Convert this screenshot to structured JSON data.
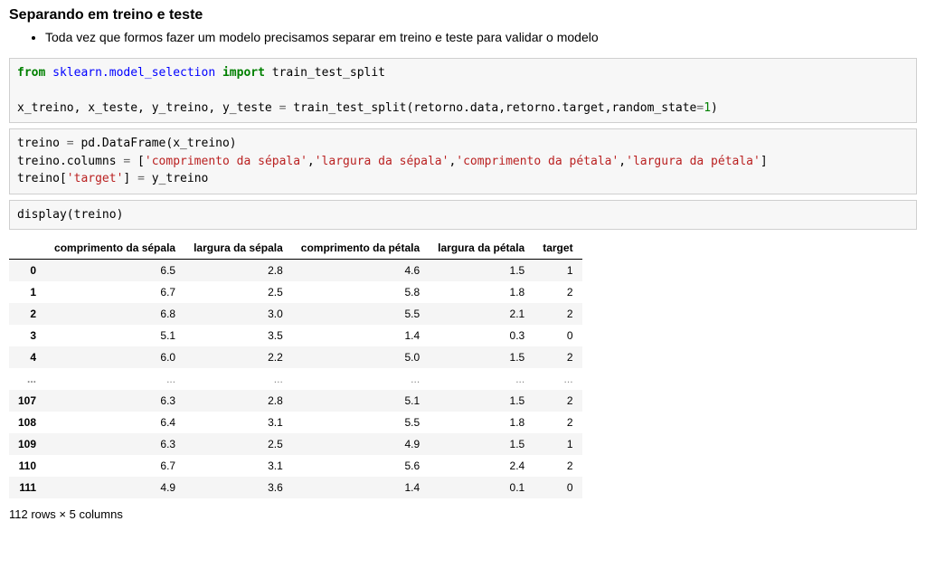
{
  "heading": "Separando em treino e teste",
  "bullet": "Toda vez que formos fazer um modelo precisamos separar em treino e teste para validar o modelo",
  "code1": {
    "l1_from": "from",
    "l1_mod": " sklearn.model_selection ",
    "l1_import": "import",
    "l1_rest": " train_test_split",
    "l2_a": "x_treino, x_teste, y_treino, y_teste ",
    "l2_eq": "=",
    "l2_b": " train_test_split(retorno.data,retorno.target,random_state",
    "l2_eq2": "=",
    "l2_num": "1",
    "l2_c": ")"
  },
  "code2": {
    "l1_a": "treino ",
    "l1_eq": "=",
    "l1_b": " pd.DataFrame(x_treino)",
    "l2_a": "treino.columns ",
    "l2_eq": "=",
    "l2_b": " [",
    "l2_s1": "'comprimento da sépala'",
    "l2_c1": ",",
    "l2_s2": "'largura da sépala'",
    "l2_c2": ",",
    "l2_s3": "'comprimento da pétala'",
    "l2_c3": ",",
    "l2_s4": "'largura da pétala'",
    "l2_d": "]",
    "l3_a": "treino[",
    "l3_s": "'target'",
    "l3_b": "] ",
    "l3_eq": "=",
    "l3_c": " y_treino"
  },
  "code3": "display(treino)",
  "chart_data": {
    "type": "table",
    "columns": [
      "comprimento da sépala",
      "largura da sépala",
      "comprimento da pétala",
      "largura da pétala",
      "target"
    ],
    "index": [
      "0",
      "1",
      "2",
      "3",
      "4",
      "...",
      "107",
      "108",
      "109",
      "110",
      "111"
    ],
    "rows": [
      [
        "6.5",
        "2.8",
        "4.6",
        "1.5",
        "1"
      ],
      [
        "6.7",
        "2.5",
        "5.8",
        "1.8",
        "2"
      ],
      [
        "6.8",
        "3.0",
        "5.5",
        "2.1",
        "2"
      ],
      [
        "5.1",
        "3.5",
        "1.4",
        "0.3",
        "0"
      ],
      [
        "6.0",
        "2.2",
        "5.0",
        "1.5",
        "2"
      ],
      [
        "...",
        "...",
        "...",
        "...",
        "..."
      ],
      [
        "6.3",
        "2.8",
        "5.1",
        "1.5",
        "2"
      ],
      [
        "6.4",
        "3.1",
        "5.5",
        "1.8",
        "2"
      ],
      [
        "6.3",
        "2.5",
        "4.9",
        "1.5",
        "1"
      ],
      [
        "6.7",
        "3.1",
        "5.6",
        "2.4",
        "2"
      ],
      [
        "4.9",
        "3.6",
        "1.4",
        "0.1",
        "0"
      ]
    ],
    "dimensions": "112 rows × 5 columns"
  }
}
